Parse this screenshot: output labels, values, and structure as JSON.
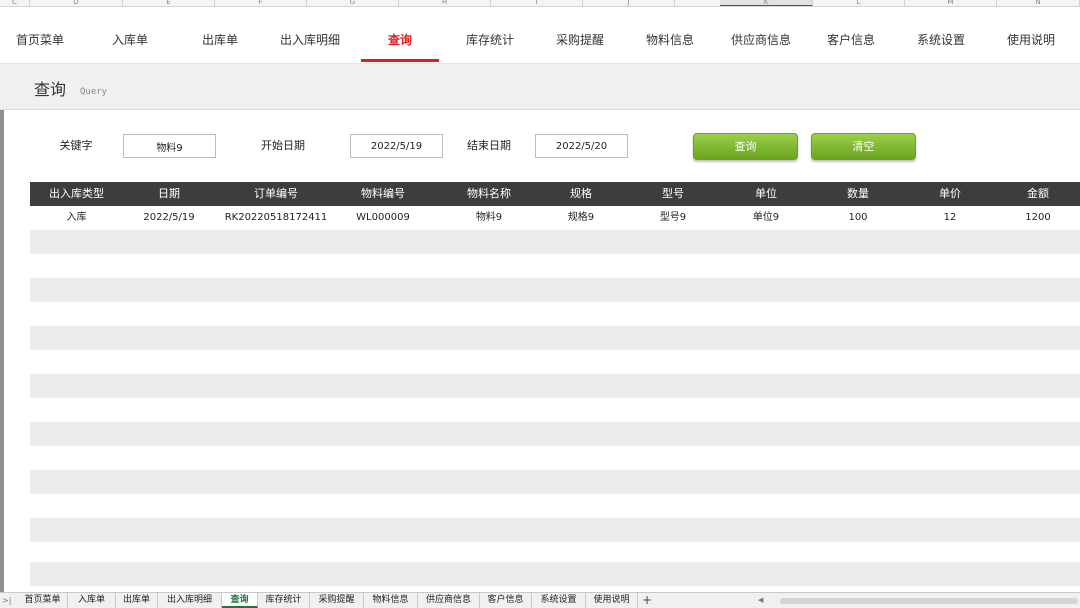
{
  "columns": [
    "C",
    "D",
    "E",
    "F",
    "G",
    "H",
    "I",
    "J",
    "K",
    "L",
    "M",
    "N"
  ],
  "nav": {
    "tabs": [
      "首页菜单",
      "入库单",
      "出库单",
      "出入库明细",
      "查询",
      "库存统计",
      "采购提醒",
      "物料信息",
      "供应商信息",
      "客户信息",
      "系统设置",
      "使用说明"
    ],
    "active": "查询"
  },
  "page": {
    "title": "查询",
    "subtitle": "Query"
  },
  "filters": {
    "keyword_label": "关键字",
    "keyword_value": "物料9",
    "start_label": "开始日期",
    "start_value": "2022/5/19",
    "end_label": "结束日期",
    "end_value": "2022/5/20",
    "search_button": "查询",
    "clear_button": "清空"
  },
  "table": {
    "headers": [
      "出入库类型",
      "日期",
      "订单编号",
      "物料编号",
      "物料名称",
      "规格",
      "型号",
      "单位",
      "数量",
      "单价",
      "金额"
    ],
    "rows": [
      [
        "入库",
        "2022/5/19",
        "RK20220518172411",
        "WL000009",
        "物料9",
        "规格9",
        "型号9",
        "单位9",
        "100",
        "12",
        "1200"
      ]
    ]
  },
  "sheets": {
    "tabs": [
      "首页菜单",
      "入库单",
      "出库单",
      "出入库明细",
      "查询",
      "库存统计",
      "采购提醒",
      "物料信息",
      "供应商信息",
      "客户信息",
      "系统设置",
      "使用说明"
    ],
    "active": "查询",
    "add_label": "+"
  },
  "colors": {
    "accent": "#e02020",
    "button": "#7db337",
    "header_bg": "#3d3d3d",
    "sheet_active": "#217346"
  }
}
